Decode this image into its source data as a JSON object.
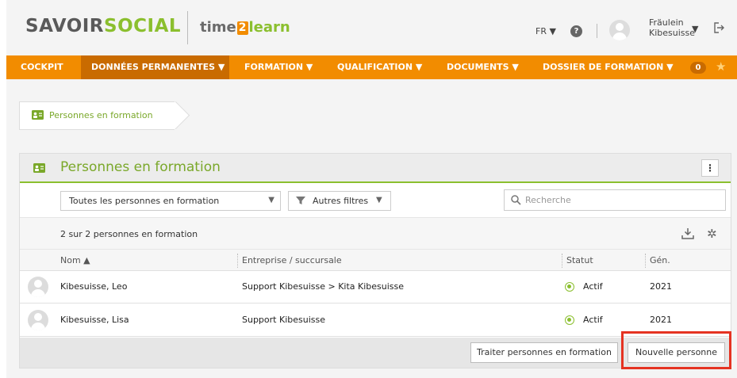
{
  "brand": {
    "logo_part1": "SAVOIR",
    "logo_part2": "SOCIAL",
    "logo2_part1": "time",
    "logo2_num": "2",
    "logo2_part2": "learn"
  },
  "header": {
    "lang": "FR ▼",
    "help": "?",
    "user_line1": "Fräulein",
    "user_line2": "Kibesuisse",
    "user_caret": "▼"
  },
  "nav": {
    "items": [
      {
        "label": "COCKPIT"
      },
      {
        "label": "DONNÉES PERMANENTES ▼"
      },
      {
        "label": "FORMATION ▼"
      },
      {
        "label": "QUALIFICATION ▼"
      },
      {
        "label": "DOCUMENTS ▼"
      },
      {
        "label": "DOSSIER DE FORMATION ▼"
      }
    ],
    "badge": "0",
    "star": "★"
  },
  "breadcrumb": {
    "label": "Personnes en formation"
  },
  "panel": {
    "title": "Personnes en formation",
    "menu": "⋮",
    "filter_select": "Toutes les personnes en formation",
    "select_caret": "▼",
    "filters_label": "Autres filtres",
    "filters_caret": "▼",
    "search_placeholder": "Recherche",
    "count": "2 sur 2 personnes en formation"
  },
  "table": {
    "columns": [
      "Nom ▲",
      "Entreprise / succursale",
      "Statut",
      "Gén."
    ],
    "rows": [
      {
        "name": "Kibesuisse, Leo",
        "company": "Support Kibesuisse > Kita Kibesuisse",
        "status": "Actif",
        "gen": "2021"
      },
      {
        "name": "Kibesuisse, Lisa",
        "company": "Support Kibesuisse",
        "status": "Actif",
        "gen": "2021"
      }
    ]
  },
  "actions": {
    "process": "Traiter personnes en formation",
    "new": "Nouvelle personne"
  },
  "colors": {
    "accent": "#f28c00",
    "brand_green": "#8bbf2e",
    "highlight": "#e53322"
  }
}
